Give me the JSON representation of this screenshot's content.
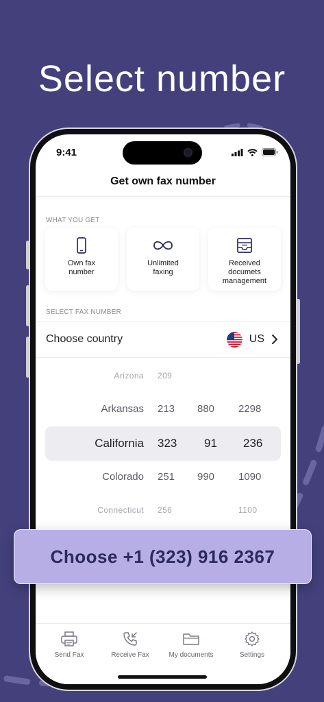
{
  "colors": {
    "background": "#44407c",
    "accent": "#b7aee6",
    "decoration": "#6a66a0"
  },
  "headline": "Select number",
  "status_bar": {
    "time": "9:41"
  },
  "header": {
    "title": "Get own fax number"
  },
  "what_you_get": {
    "label": "WHAT YOU GET",
    "cards": [
      {
        "icon": "phone-icon",
        "label": "Own fax\nnumber"
      },
      {
        "icon": "infinity-icon",
        "label": "Unlimited\nfaxing"
      },
      {
        "icon": "inbox-tray-icon",
        "label": "Received\ndocumets\nmanagement"
      }
    ]
  },
  "select_fax": {
    "label": "SELECT FAX NUMBER",
    "country_label": "Choose country",
    "country_code": "US",
    "flag_icon": "us-flag-icon"
  },
  "picker": {
    "rows": [
      {
        "state": "Arizona",
        "c1": "209",
        "c2": "",
        "c3": ""
      },
      {
        "state": "Arkansas",
        "c1": "213",
        "c2": "880",
        "c3": "2298"
      },
      {
        "state": "California",
        "c1": "323",
        "c2": "91",
        "c3": "236"
      },
      {
        "state": "Colorado",
        "c1": "251",
        "c2": "990",
        "c3": "1090"
      },
      {
        "state": "Connecticut",
        "c1": "256",
        "c2": "",
        "c3": "1100"
      }
    ]
  },
  "cta": {
    "label": "Choose +1 (323) 916 2367"
  },
  "tabbar": {
    "tabs": [
      {
        "icon": "printer-icon",
        "label": "Send Fax"
      },
      {
        "icon": "phone-incoming-icon",
        "label": "Receive Fax"
      },
      {
        "icon": "folder-icon",
        "label": "My documents"
      },
      {
        "icon": "gear-icon",
        "label": "Settings"
      }
    ]
  }
}
